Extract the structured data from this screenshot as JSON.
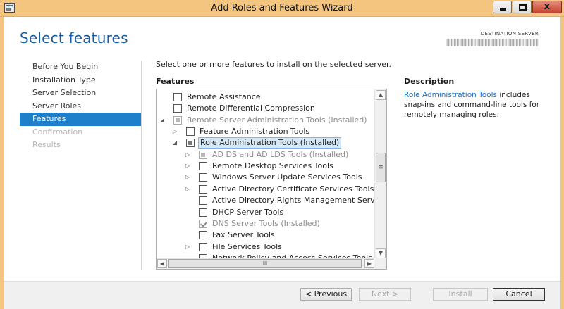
{
  "window": {
    "title": "Add Roles and Features Wizard",
    "controls": {
      "close": "x"
    }
  },
  "page_title": "Select features",
  "destination": {
    "label": "DESTINATION SERVER"
  },
  "nav": {
    "items": [
      {
        "label": "Before You Begin",
        "state": "normal"
      },
      {
        "label": "Installation Type",
        "state": "normal"
      },
      {
        "label": "Server Selection",
        "state": "normal"
      },
      {
        "label": "Server Roles",
        "state": "normal"
      },
      {
        "label": "Features",
        "state": "active"
      },
      {
        "label": "Confirmation",
        "state": "disabled"
      },
      {
        "label": "Results",
        "state": "disabled"
      }
    ]
  },
  "main": {
    "instruction": "Select one or more features to install on the selected server.",
    "features_header": "Features",
    "tree": [
      {
        "label": "Remote Assistance",
        "check": "unchecked",
        "expander": "none"
      },
      {
        "label": "Remote Differential Compression",
        "check": "unchecked",
        "expander": "none"
      },
      {
        "label": "Remote Server Administration Tools (Installed)",
        "check": "indeterminate",
        "expander": "expanded",
        "grey": true
      },
      {
        "label": "Feature Administration Tools",
        "check": "unchecked",
        "expander": "collapsed"
      },
      {
        "label": "Role Administration Tools (Installed)",
        "check": "indeterminate",
        "expander": "expanded",
        "selected": true
      },
      {
        "label": "AD DS and AD LDS Tools (Installed)",
        "check": "indeterminate",
        "expander": "collapsed",
        "grey": true
      },
      {
        "label": "Remote Desktop Services Tools",
        "check": "unchecked",
        "expander": "collapsed"
      },
      {
        "label": "Windows Server Update Services Tools",
        "check": "unchecked",
        "expander": "collapsed"
      },
      {
        "label": "Active Directory Certificate Services Tools",
        "check": "unchecked",
        "expander": "collapsed"
      },
      {
        "label": "Active Directory Rights Management Services Tools",
        "check": "unchecked",
        "expander": "none"
      },
      {
        "label": "DHCP Server Tools",
        "check": "unchecked",
        "expander": "none"
      },
      {
        "label": "DNS Server Tools (Installed)",
        "check": "checked",
        "expander": "none",
        "grey": true
      },
      {
        "label": "Fax Server Tools",
        "check": "unchecked",
        "expander": "none"
      },
      {
        "label": "File Services Tools",
        "check": "unchecked",
        "expander": "collapsed"
      },
      {
        "label": "Network Policy and Access Services Tools",
        "check": "unchecked",
        "expander": "none"
      }
    ],
    "scroll": {
      "grip": "≡",
      "hgrip": "III"
    }
  },
  "description": {
    "header": "Description",
    "link": "Role Administration Tools",
    "text": " includes snap-ins and command-line tools for remotely managing roles."
  },
  "buttons": {
    "previous": "< Previous",
    "next": "Next >",
    "install": "Install",
    "cancel": "Cancel"
  },
  "colors": {
    "titlebar": "#f3c57f",
    "accent": "#1e7fcb",
    "page_title": "#1b5d9e",
    "link": "#1b6ec2"
  }
}
